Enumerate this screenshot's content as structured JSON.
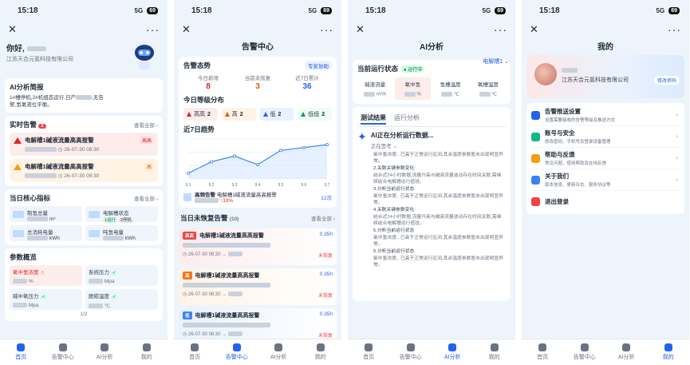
{
  "status": {
    "time": "15:18",
    "signal": "5G"
  },
  "tabbar": [
    "首页",
    "告警中心",
    "AI分析",
    "我的"
  ],
  "s1": {
    "greeting": "你好,",
    "company": "江苏天合元氢科技有限公司",
    "ai_brief": {
      "title": "AI分析简报",
      "text1": "1#槽停机,2#机组态运行,日产",
      "text2": "无告",
      "text3": "警,氢氧液位平衡。"
    },
    "realtime": {
      "title": "实时告警",
      "count": "2",
      "more": "查看全部 ›",
      "items": [
        {
          "title": "电解槽1碱液流量高高报警",
          "time": "26-07-30 08:30",
          "level": "高高"
        },
        {
          "title": "电解槽1碱液流量高高报警",
          "time": "26-07-30 08:30",
          "level": "高"
        }
      ]
    },
    "metrics": {
      "title": "当日核心指标",
      "more": "查看全部 ›",
      "items": [
        {
          "name": "制氢总量",
          "unit": "m³"
        },
        {
          "name": "电解槽状态",
          "tag1": "1运行",
          "tag2": "2停机"
        },
        {
          "name": "总消耗电量",
          "unit": "kWh"
        },
        {
          "name": "吨氢电量",
          "unit": "kWh"
        }
      ]
    },
    "params": {
      "title": "参数概览",
      "page": "1/2",
      "items": [
        {
          "name": "氧中氢浓度",
          "unit": "%",
          "tag": "!"
        },
        {
          "name": "系统压力",
          "unit": "Mpa",
          "tag": "✓"
        },
        {
          "name": "碱中氧压力",
          "unit": "Mpa",
          "tag": "✓"
        },
        {
          "name": "脱碳温度",
          "unit": "℃",
          "tag": "✓"
        }
      ]
    }
  },
  "s2": {
    "title": "告警中心",
    "posture": {
      "title": "告警态势",
      "expert": "专家协助",
      "stats": [
        {
          "label": "今日新增",
          "value": "8"
        },
        {
          "label": "当前未恢复",
          "value": "3"
        },
        {
          "label": "近7日累计",
          "value": "36"
        }
      ]
    },
    "levels": {
      "title": "今日等级分布",
      "items": [
        {
          "label": "高高",
          "value": "2"
        },
        {
          "label": "高",
          "value": "2"
        },
        {
          "label": "低",
          "value": "2"
        },
        {
          "label": "低低",
          "value": "2"
        }
      ]
    },
    "trend": {
      "title": "近7日趋势",
      "note_title": "高频告警",
      "note_text": "电解槽1碱液流量高高报警",
      "note_pct": "↑33%",
      "note_count": "12次"
    },
    "unresolved": {
      "title": "当日未恢复告警",
      "count": "(10)",
      "more": "查看全部 ›",
      "items": [
        {
          "badge": "高高",
          "title": "电解槽1碱液流量高高报警",
          "dur": "0.35h",
          "time": "26-07-30 08:30",
          "state": "未恢复"
        },
        {
          "badge": "高",
          "title": "电解槽1碱液流量高高报警",
          "dur": "0.35h",
          "time": "26-07-30 08:30",
          "state": "未恢复"
        },
        {
          "badge": "低",
          "title": "电解槽1碱液流量高高报警",
          "dur": "0.35h",
          "time": "26-07-30 08:30",
          "state": "未恢复"
        }
      ]
    }
  },
  "chart_data": {
    "type": "line",
    "categories": [
      "9.1",
      "9.2",
      "9.3",
      "9.4",
      "9.5",
      "9.6",
      "9.7"
    ],
    "values": [
      2,
      6,
      8,
      5,
      10,
      11,
      12
    ],
    "title": "近7日趋势",
    "xlabel": "",
    "ylabel": "",
    "ylim": [
      0,
      14
    ],
    "grid": true
  },
  "s3": {
    "title": "AI分析",
    "device": "电解槽1 ⌄",
    "state": {
      "title": "当前运行状态",
      "badge": "● 运行中",
      "kpis": [
        {
          "name": "碱液流量",
          "unit": "m³/h"
        },
        {
          "name": "氧中氢",
          "unit": "%"
        },
        {
          "name": "氢槽温度",
          "unit": "℃"
        },
        {
          "name": "氧槽温度",
          "unit": "℃"
        }
      ]
    },
    "tabs": [
      "测试结果",
      "运行分析"
    ],
    "ai_title": "AI正在分析运行数据...",
    "ai_think": "正在思考 ⌄",
    "lines": [
      "氧中氢浓度:, 已高于正常运行区间;其余温度参数暂未出现明显异常。",
      "2.关联关键参数变化:",
      "结合近24小时数据,流量升高与碱液流量波动存在时间关联,需继续结合电解槽运行值班。",
      "3.分析当前运行状态",
      "氧中氢浓度:, 已高于正常运行区间;其余温度参数暂未出现明显异常。",
      "4.关联关键参数变化:",
      "结合近24小时数据,流量升高与碱液流量波动存在时间关联,需继续结合电解槽运行值班。",
      "5.分析当前运行状态",
      "氧中氢浓度:, 已高于正常运行区间;其余温度参数暂未出现明显异常。",
      "5.分析当前运行状态",
      "氧中氢浓度:, 已高于正常运行区间;其余温度参数暂未出现明显异常。"
    ]
  },
  "s4": {
    "title": "我的",
    "company": "江苏天合元氢科技有限公司",
    "edit": "修改密码",
    "menu": [
      {
        "t1": "告警推送设置",
        "t2": "设置需要接收的告警等级及推送方式",
        "color": "#2563eb"
      },
      {
        "t1": "账号与安全",
        "t2": "修改密码、手机号及登录设备管理",
        "color": "#10b981"
      },
      {
        "t1": "帮助与反馈",
        "t2": "常见问题、使用帮助及在线反馈",
        "color": "#f59e0b"
      },
      {
        "t1": "关于我们",
        "t2": "版本信息、更新日志、服务协议等",
        "color": "#3b82f6"
      },
      {
        "t1": "退出登录",
        "t2": "",
        "color": "#ef4444"
      }
    ]
  }
}
